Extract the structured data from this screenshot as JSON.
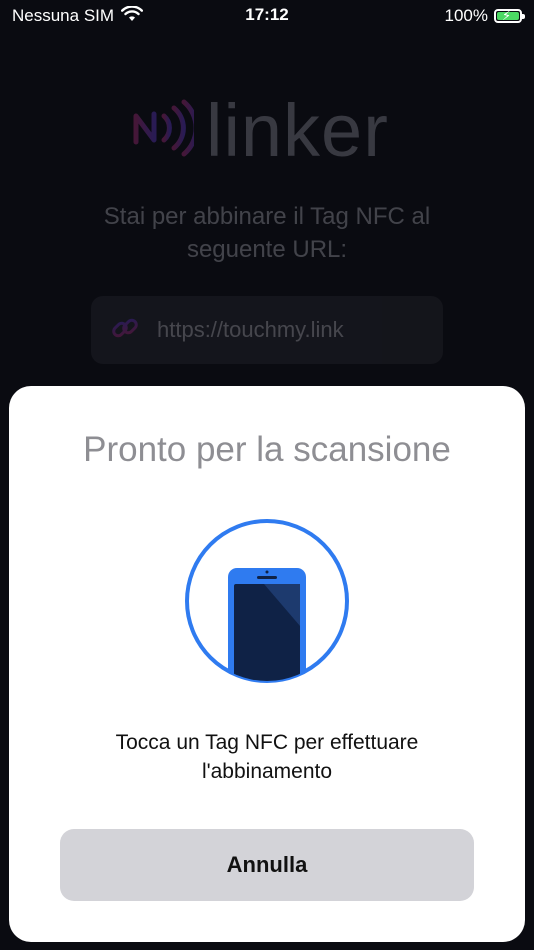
{
  "status_bar": {
    "carrier": "Nessuna SIM",
    "time": "17:12",
    "battery": "100%",
    "icons": [
      "wifi-icon",
      "battery-charging-icon"
    ]
  },
  "background_app": {
    "logo_text": "linker",
    "intro": "Stai per abbinare il Tag NFC al seguente URL:",
    "url": "https://touchmy.link",
    "icons": [
      "nfc-waves-icon",
      "link-icon"
    ]
  },
  "nfc_sheet": {
    "title": "Pronto per la scansione",
    "message": "Tocca un Tag NFC per effettuare l'abbinamento",
    "cancel_label": "Annulla",
    "accent_color": "#2f7bf0",
    "icons": [
      "phone-scan-icon"
    ]
  }
}
